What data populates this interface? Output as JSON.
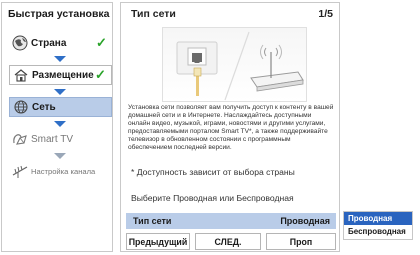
{
  "left_panel": {
    "title": "Быстрая установка",
    "steps": [
      {
        "label": "Страна",
        "icon": "globe-icon",
        "checked": "✓"
      },
      {
        "label": "Размещение",
        "icon": "house-icon",
        "checked": "✓"
      },
      {
        "label": "Сеть",
        "icon": "network-icon"
      },
      {
        "label": "Smart TV",
        "icon": "smart-tv-icon"
      },
      {
        "label": "Настройка канала",
        "icon": "antenna-icon"
      }
    ]
  },
  "main": {
    "title": "Тип сети",
    "page_indicator": "1/5",
    "description": "Установка сети позволяет вам получить доступ к контенту в вашей домашней сети и в Интернете. Наслаждайтесь доступными онлайн видео, музыкой, играми, новостями и другими услугами, предоставляемыми порталом Smart TV*, а также поддерживайте телевизор в обновленном состоянии с программным обеспечением последней версии.",
    "note": "* Доступность зависит от выбора страны",
    "prompt": "Выберите Проводная или Беспроводная",
    "setting": {
      "label": "Тип сети",
      "value": "Проводная"
    },
    "buttons": {
      "prev": "Предыдущий",
      "next": "СЛЕД.",
      "skip": "Проп"
    }
  },
  "dropdown": {
    "options": [
      "Проводная",
      "Беспроводная"
    ],
    "selected": "Проводная"
  },
  "colors": {
    "accent": "#2a64bf",
    "highlight": "#b9cce8",
    "check": "#29a329",
    "arrow": "#2f6fc7"
  }
}
